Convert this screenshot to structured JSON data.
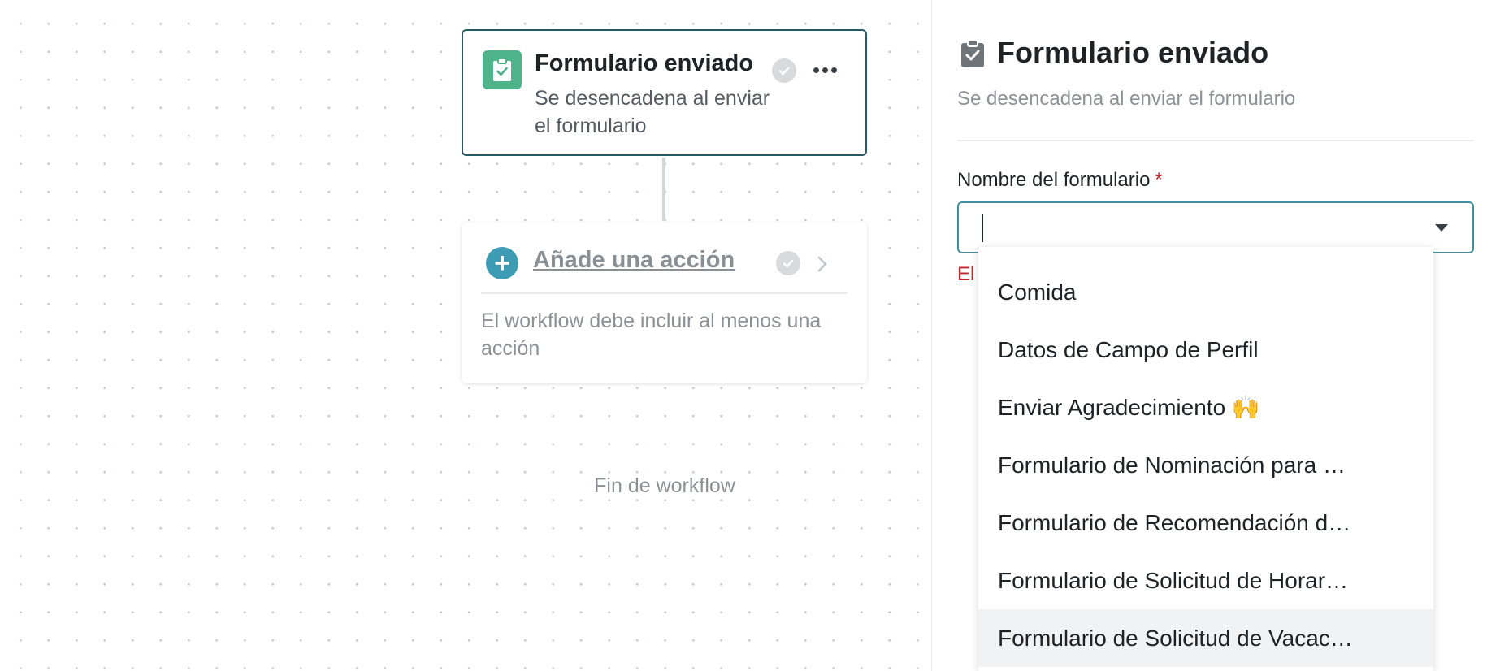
{
  "workflow": {
    "trigger_card": {
      "title": "Formulario enviado",
      "subtitle": "Se desencadena al enviar el formulario",
      "icon": "clipboard-check-icon",
      "status_icon": "check-circle-icon",
      "menu_icon": "more-horizontal-icon"
    },
    "action_card": {
      "label": "Añade una acción",
      "note": "El workflow debe incluir al menos una acción",
      "icon": "plus-circle-icon",
      "status_icon": "check-circle-icon",
      "chevron_icon": "chevron-right-icon"
    },
    "end_label": "Fin de workflow"
  },
  "panel": {
    "title": "Formulario enviado",
    "subtitle": "Se desencadena al enviar el formulario",
    "field": {
      "label": "Nombre del formulario",
      "required_mark": "*",
      "value": "",
      "error_text": "El"
    },
    "dropdown": {
      "options": [
        "Comida",
        "Datos de Campo de Perfil",
        "Enviar Agradecimiento 🙌",
        "Formulario de Nominación para …",
        "Formulario de Recomendación d…",
        "Formulario de Solicitud de Horar…",
        "Formulario de Solicitud de Vacac…"
      ],
      "highlighted_index": 6
    }
  },
  "colors": {
    "trigger_accent": "#4fb48c",
    "action_accent": "#3d9cb4",
    "card_border": "#2a5a64",
    "error": "#c3242b"
  }
}
